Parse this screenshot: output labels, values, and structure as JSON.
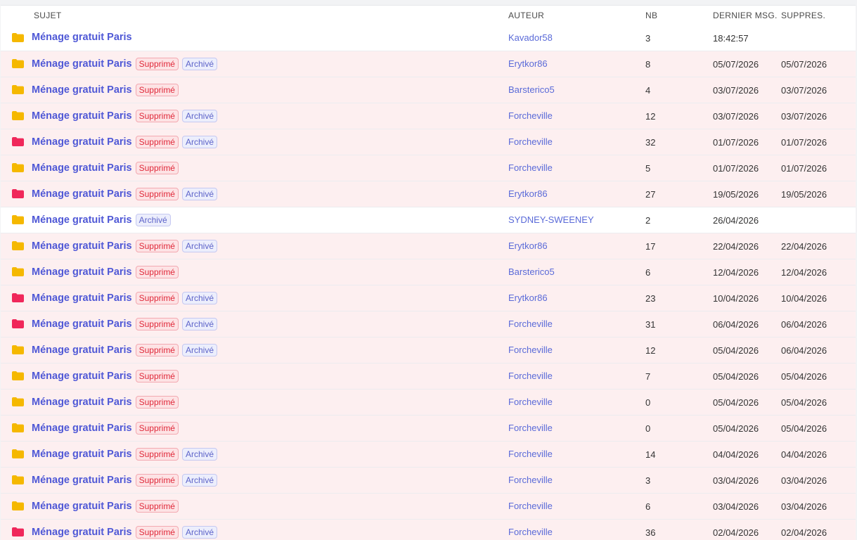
{
  "header": {
    "subject": "SUJET",
    "author": "AUTEUR",
    "nb": "NB",
    "last": "DERNIER MSG.",
    "deleted": "SUPPRES."
  },
  "colors": {
    "folder_yellow": "#f5b800",
    "folder_red": "#f0275a",
    "deleted_row_bg": "#fdeff0"
  },
  "rows": [
    {
      "folder": "yellow",
      "title": "Ménage gratuit Paris",
      "sup": false,
      "arc": false,
      "author": "Kavador58",
      "nb": "3",
      "last": "18:42:57",
      "del": ""
    },
    {
      "folder": "yellow",
      "title": "Ménage gratuit Paris",
      "sup": true,
      "arc": true,
      "author": "Erytkor86",
      "nb": "8",
      "last": "05/07/2026",
      "del": "05/07/2026"
    },
    {
      "folder": "yellow",
      "title": "Ménage gratuit Paris",
      "sup": true,
      "arc": false,
      "author": "Barsterico5",
      "nb": "4",
      "last": "03/07/2026",
      "del": "03/07/2026"
    },
    {
      "folder": "yellow",
      "title": "Ménage gratuit Paris",
      "sup": true,
      "arc": true,
      "author": "Forcheville",
      "nb": "12",
      "last": "03/07/2026",
      "del": "03/07/2026"
    },
    {
      "folder": "red",
      "title": "Ménage gratuit Paris",
      "sup": true,
      "arc": true,
      "author": "Forcheville",
      "nb": "32",
      "last": "01/07/2026",
      "del": "01/07/2026"
    },
    {
      "folder": "yellow",
      "title": "Ménage gratuit Paris",
      "sup": true,
      "arc": false,
      "author": "Forcheville",
      "nb": "5",
      "last": "01/07/2026",
      "del": "01/07/2026"
    },
    {
      "folder": "red",
      "title": "Ménage gratuit Paris",
      "sup": true,
      "arc": true,
      "author": "Erytkor86",
      "nb": "27",
      "last": "19/05/2026",
      "del": "19/05/2026"
    },
    {
      "folder": "yellow",
      "title": "Ménage gratuit Paris",
      "sup": false,
      "arc": true,
      "author": "SYDNEY-SWEENEY",
      "nb": "2",
      "last": "26/04/2026",
      "del": ""
    },
    {
      "folder": "yellow",
      "title": "Ménage gratuit Paris",
      "sup": true,
      "arc": true,
      "author": "Erytkor86",
      "nb": "17",
      "last": "22/04/2026",
      "del": "22/04/2026"
    },
    {
      "folder": "yellow",
      "title": "Ménage gratuit Paris",
      "sup": true,
      "arc": false,
      "author": "Barsterico5",
      "nb": "6",
      "last": "12/04/2026",
      "del": "12/04/2026"
    },
    {
      "folder": "red",
      "title": "Ménage gratuit Paris",
      "sup": true,
      "arc": true,
      "author": "Erytkor86",
      "nb": "23",
      "last": "10/04/2026",
      "del": "10/04/2026"
    },
    {
      "folder": "red",
      "title": "Ménage gratuit Paris",
      "sup": true,
      "arc": true,
      "author": "Forcheville",
      "nb": "31",
      "last": "06/04/2026",
      "del": "06/04/2026"
    },
    {
      "folder": "yellow",
      "title": "Ménage gratuit Paris",
      "sup": true,
      "arc": true,
      "author": "Forcheville",
      "nb": "12",
      "last": "05/04/2026",
      "del": "06/04/2026"
    },
    {
      "folder": "yellow",
      "title": "Ménage gratuit Paris",
      "sup": true,
      "arc": false,
      "author": "Forcheville",
      "nb": "7",
      "last": "05/04/2026",
      "del": "05/04/2026"
    },
    {
      "folder": "yellow",
      "title": "Ménage gratuit Paris",
      "sup": true,
      "arc": false,
      "author": "Forcheville",
      "nb": "0",
      "last": "05/04/2026",
      "del": "05/04/2026"
    },
    {
      "folder": "yellow",
      "title": "Ménage gratuit Paris",
      "sup": true,
      "arc": false,
      "author": "Forcheville",
      "nb": "0",
      "last": "05/04/2026",
      "del": "05/04/2026"
    },
    {
      "folder": "yellow",
      "title": "Ménage gratuit Paris",
      "sup": true,
      "arc": true,
      "author": "Forcheville",
      "nb": "14",
      "last": "04/04/2026",
      "del": "04/04/2026"
    },
    {
      "folder": "yellow",
      "title": "Ménage gratuit Paris",
      "sup": true,
      "arc": true,
      "author": "Forcheville",
      "nb": "3",
      "last": "03/04/2026",
      "del": "03/04/2026"
    },
    {
      "folder": "yellow",
      "title": "Ménage gratuit Paris",
      "sup": true,
      "arc": false,
      "author": "Forcheville",
      "nb": "6",
      "last": "03/04/2026",
      "del": "03/04/2026"
    },
    {
      "folder": "red",
      "title": "Ménage gratuit Paris",
      "sup": true,
      "arc": true,
      "author": "Forcheville",
      "nb": "36",
      "last": "02/04/2026",
      "del": "02/04/2026"
    }
  ],
  "labels": {
    "deleted_badge": "Supprimé",
    "archived_badge": "Archivé"
  }
}
